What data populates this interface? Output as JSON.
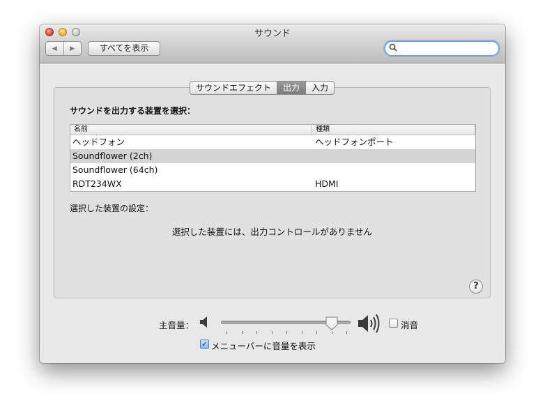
{
  "window": {
    "title": "サウンド",
    "nav_back": "◀",
    "nav_forward": "▶",
    "show_all": "すべてを表示",
    "search_placeholder": "",
    "search_icon": "magnifier-icon"
  },
  "tabs": [
    {
      "label": "サウンドエフェクト",
      "active": false
    },
    {
      "label": "出力",
      "active": true
    },
    {
      "label": "入力",
      "active": false
    }
  ],
  "output": {
    "section_title": "サウンドを出力する装置を選択：",
    "columns": [
      "名前",
      "種類"
    ],
    "rows": [
      {
        "name": "ヘッドフォン",
        "type": "ヘッドフォンポート",
        "selected": false
      },
      {
        "name": "Soundflower (2ch)",
        "type": "",
        "selected": true
      },
      {
        "name": "Soundflower (64ch)",
        "type": "",
        "selected": false
      },
      {
        "name": "RDT234WX",
        "type": "HDMI",
        "selected": false
      }
    ],
    "settings_label": "選択した装置の設定：",
    "no_controls_message": "選択した装置には、出力コントロールがありません",
    "help": "?"
  },
  "volume": {
    "label": "主音量：",
    "level": 0.86,
    "mute_label": "消音",
    "mute_checked": false,
    "show_in_menubar_label": "メニューバーに音量を表示",
    "show_in_menubar_checked": true
  },
  "colors": {
    "selected_row": "#d4d4d4",
    "active_tab": "#8a8a8a",
    "search_focus": "#8cb1e8"
  }
}
